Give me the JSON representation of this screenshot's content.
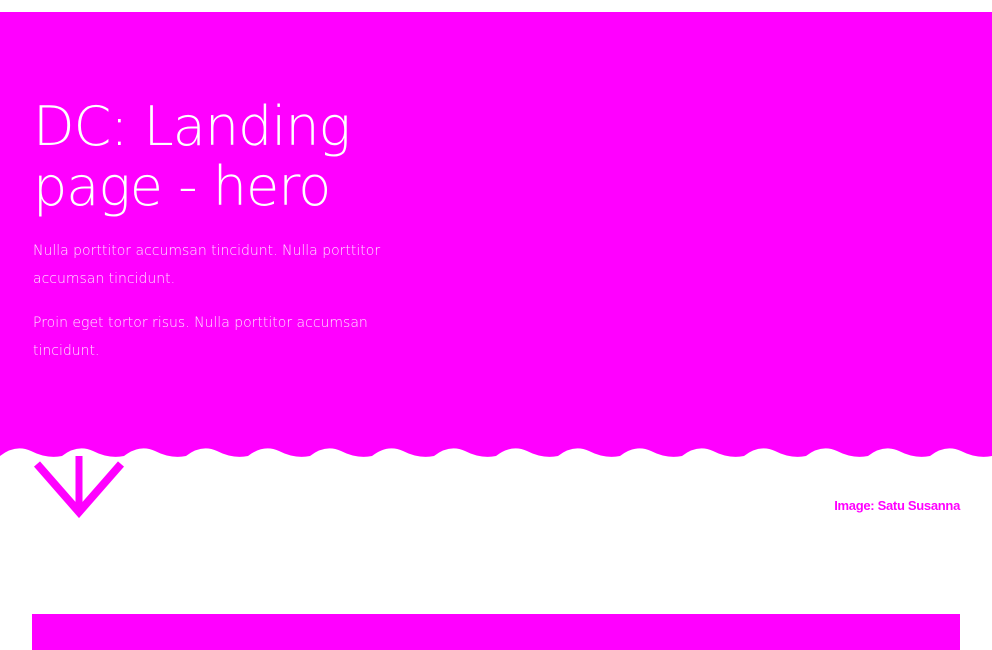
{
  "hero": {
    "title": "DC: Landing page - hero",
    "paragraphs": [
      "Nulla porttitor accumsan tincidunt. Nulla porttitor accumsan tincidunt.",
      "Proin eget tortor risus. Nulla porttitor accumsan tincidunt."
    ],
    "background_color": "#ff00ff",
    "text_color": "#ffffff"
  },
  "scroll_icon": "chevron-down-arrow",
  "image_credit": "Image: Satu Susanna",
  "accent_color": "#ff00ff"
}
